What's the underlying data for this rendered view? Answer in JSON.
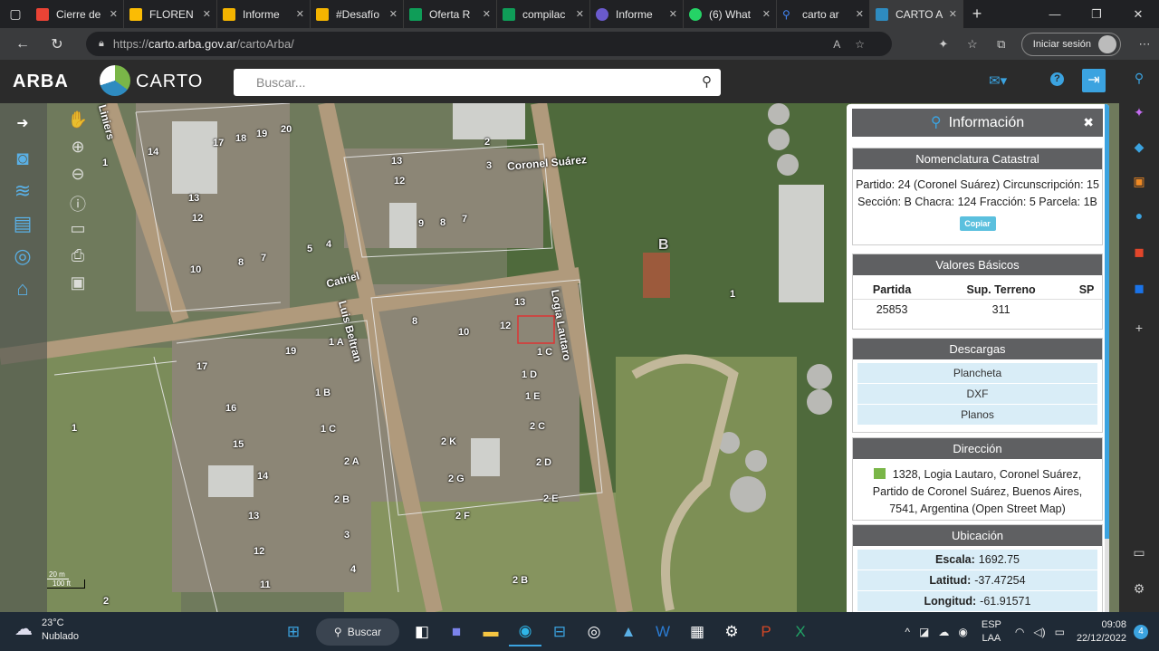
{
  "browser": {
    "tabs": [
      {
        "label": "Cierre de",
        "color": "#ea4335"
      },
      {
        "label": "FLOREN",
        "color": "#fbbc04"
      },
      {
        "label": "Informe",
        "color": "#f4b400"
      },
      {
        "label": "#Desafío",
        "color": "#f4b400"
      },
      {
        "label": "Oferta R",
        "color": "#0f9d58"
      },
      {
        "label": "compilac",
        "color": "#0f9d58"
      },
      {
        "label": "Informe",
        "color": "#6a5acd"
      },
      {
        "label": "(6) What",
        "color": "#25d366"
      },
      {
        "label": "carto ar",
        "color": "#4285f4"
      },
      {
        "label": "CARTO A",
        "color": "#2e8bc0"
      }
    ],
    "url_prefix": "https://",
    "url_host": "carto.arba.gov.ar",
    "url_path": "/cartoArba/",
    "signin_label": "Iniciar sesión"
  },
  "app": {
    "brand": "ARBA",
    "product": "CARTO",
    "search_placeholder": "Buscar...",
    "accent": "#3ba3e0"
  },
  "map": {
    "streets": [
      "Coronel Suárez",
      "Catriel",
      "Luis Beltran",
      "Logia Lautaro",
      "Liniers"
    ],
    "scale_top": "20 m",
    "scale_bottom": "100 ft"
  },
  "panel": {
    "title": "Información",
    "nomenclatura": {
      "header": "Nomenclatura Catastral",
      "text": "Partido: 24 (Coronel Suárez) Circunscripción: 15 Sección: B Chacra: 124 Fracción: 5 Parcela: 1B",
      "copy_label": "Copiar"
    },
    "valores": {
      "header": "Valores Básicos",
      "columns": [
        "Partida",
        "Sup. Terreno",
        "SP"
      ],
      "row": [
        "25853",
        "311",
        ""
      ]
    },
    "descargas": {
      "header": "Descargas",
      "items": [
        "Plancheta",
        "DXF",
        "Planos"
      ]
    },
    "direccion": {
      "header": "Dirección",
      "text": "1328, Logia Lautaro, Coronel Suárez, Partido de Coronel Suárez, Buenos Aires, 7541, Argentina (Open Street Map)"
    },
    "ubicacion": {
      "header": "Ubicación",
      "escala_label": "Escala:",
      "escala_value": "1692.75",
      "latitud_label": "Latitud:",
      "latitud_value": "-37.47254",
      "longitud_label": "Longitud:",
      "longitud_value": "-61.91571"
    }
  },
  "taskbar": {
    "temp": "23°C",
    "weather": "Nublado",
    "search_label": "Buscar",
    "lang1": "ESP",
    "lang2": "LAA",
    "time": "09:08",
    "date": "22/12/2022",
    "notifications": "4"
  }
}
